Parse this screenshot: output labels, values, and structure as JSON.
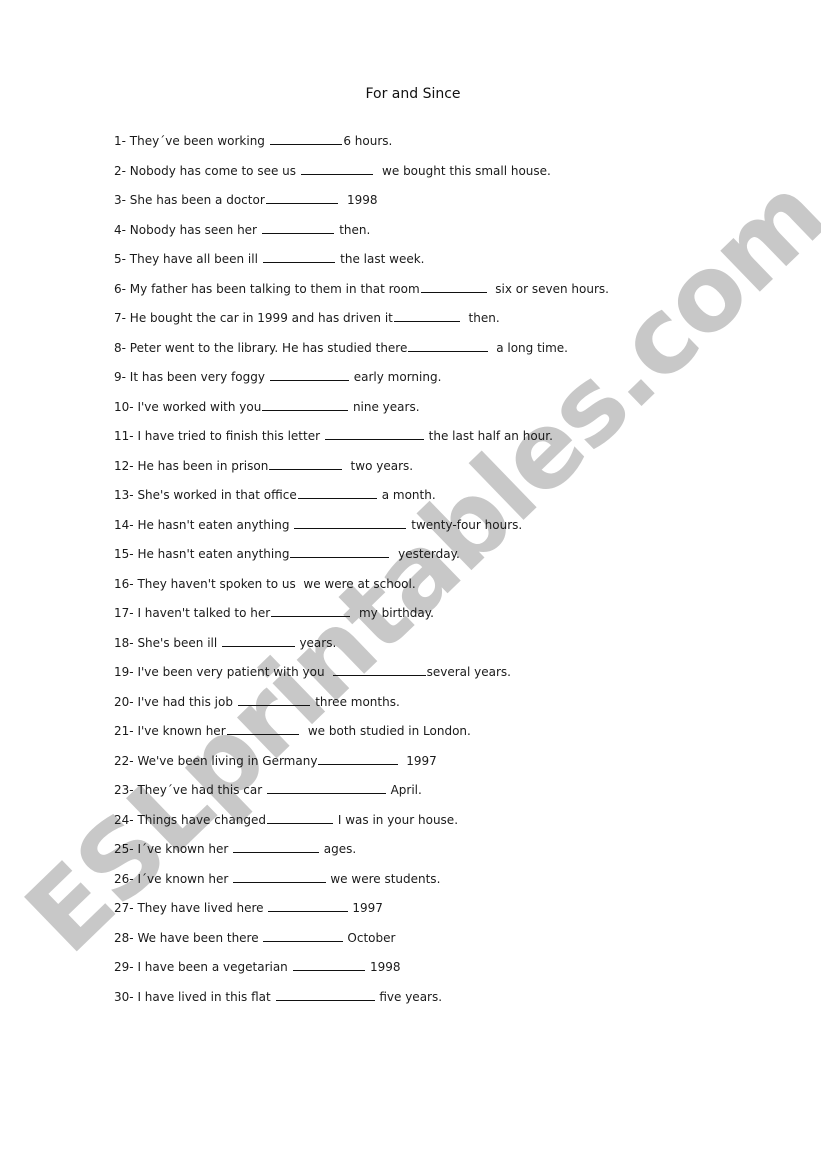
{
  "document": {
    "title": "For and Since",
    "watermark": "ESLprintables.com",
    "exercises": [
      {
        "number": "1-",
        "before": "They´ve been working ",
        "blank_chars": 11,
        "after": "6 hours."
      },
      {
        "number": "2-",
        "before": "Nobody has come to see us ",
        "blank_chars": 11,
        "after": "  we bought this small house."
      },
      {
        "number": "3-",
        "before": "She has been a doctor",
        "blank_chars": 11,
        "after": "  1998"
      },
      {
        "number": "4-",
        "before": "Nobody has seen her ",
        "blank_chars": 11,
        "after": " then."
      },
      {
        "number": "5-",
        "before": "They have all been ill ",
        "blank_chars": 11,
        "after": " the last week."
      },
      {
        "number": "6-",
        "before": "My father has been talking to them in that room",
        "blank_chars": 10,
        "after": "  six or seven hours."
      },
      {
        "number": "7-",
        "before": "He bought the car in 1999 and has driven it",
        "blank_chars": 10,
        "after": "  then."
      },
      {
        "number": "8-",
        "before": "Peter went to the library. He has studied there",
        "blank_chars": 12,
        "after": "  a long time."
      },
      {
        "number": "9-",
        "before": "It has been very foggy ",
        "blank_chars": 12,
        "after": " early morning."
      },
      {
        "number": "10-",
        "before": "I've worked with you",
        "blank_chars": 13,
        "after": " nine years."
      },
      {
        "number": "11-",
        "before": "I have tried to finish this letter ",
        "blank_chars": 15,
        "after": " the last half an hour."
      },
      {
        "number": "12-",
        "before": "He has been in prison",
        "blank_chars": 11,
        "after": "  two years."
      },
      {
        "number": "13-",
        "before": "She's worked in that office",
        "blank_chars": 12,
        "after": " a month."
      },
      {
        "number": "14-",
        "before": "He hasn't eaten anything ",
        "blank_chars": 17,
        "after": " twenty-four hours."
      },
      {
        "number": "15-",
        "before": "He hasn't eaten anything",
        "blank_chars": 15,
        "after": "  yesterday."
      },
      {
        "number": "16-",
        "before": "They haven't spoken to us  we were at school.",
        "blank_chars": 0,
        "after": ""
      },
      {
        "number": "17-",
        "before": "I haven't talked to her",
        "blank_chars": 12,
        "after": "  my birthday."
      },
      {
        "number": "18-",
        "before": "She's been ill ",
        "blank_chars": 11,
        "after": " years."
      },
      {
        "number": "19-",
        "before": "I've been very patient with you  ",
        "blank_chars": 14,
        "after": "several years."
      },
      {
        "number": "20-",
        "before": "I've had this job ",
        "blank_chars": 11,
        "after": " three months."
      },
      {
        "number": "21-",
        "before": "I've known her",
        "blank_chars": 11,
        "after": "  we both studied in London."
      },
      {
        "number": "22-",
        "before": "We've been living in Germany",
        "blank_chars": 12,
        "after": "  1997"
      },
      {
        "number": "23-",
        "before": "They´ve had this car ",
        "blank_chars": 18,
        "after": " April."
      },
      {
        "number": "24-",
        "before": "Things have changed",
        "blank_chars": 10,
        "after": " I was in your house."
      },
      {
        "number": "25-",
        "before": "I´ve known her ",
        "blank_chars": 13,
        "after": " ages."
      },
      {
        "number": "26-",
        "before": "I´ve known her ",
        "blank_chars": 14,
        "after": " we were students."
      },
      {
        "number": "27-",
        "before": "They have lived here ",
        "blank_chars": 12,
        "after": " 1997"
      },
      {
        "number": "28-",
        "before": "We have been there ",
        "blank_chars": 12,
        "after": " October"
      },
      {
        "number": "29-",
        "before": "I have been a vegetarian ",
        "blank_chars": 11,
        "after": " 1998"
      },
      {
        "number": "30-",
        "before": "I have lived in this flat ",
        "blank_chars": 15,
        "after": " five years."
      }
    ]
  }
}
